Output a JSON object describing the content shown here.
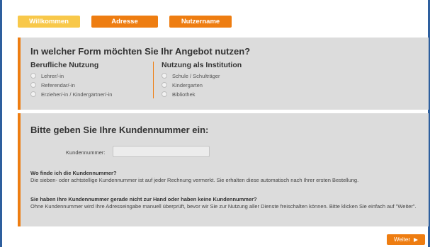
{
  "steps": [
    {
      "label": "Willkommen",
      "state": "done"
    },
    {
      "label": "Adresse",
      "state": "active"
    },
    {
      "label": "Nutzername",
      "state": "active"
    }
  ],
  "usage_section": {
    "title": "In welcher Form möchten Sie Ihr Angebot nutzen?",
    "professional": {
      "title": "Berufliche Nutzung",
      "options": [
        "Lehrer/-in",
        "Referendar/-in",
        "Erzieher/-in / Kindergärtner/-in"
      ]
    },
    "institution": {
      "title": "Nutzung als Institution",
      "options": [
        "Schule / Schulträger",
        "Kindergarten",
        "Bibliothek"
      ]
    }
  },
  "customer_section": {
    "title": "Bitte geben Sie Ihre Kundennummer ein:",
    "field_label": "Kundennummer:",
    "field_value": "",
    "faq": [
      {
        "question": "Wo finde ich die Kundennummer?",
        "answer": "Die sieben- oder achtstellige Kundennummer ist auf jeder Rechnung vermerkt. Sie erhalten diese automatisch nach Ihrer ersten Bestellung."
      },
      {
        "question": "Sie haben Ihre Kundennummer gerade nicht zur Hand oder haben keine Kundennummer?",
        "answer": "Ohne Kundennummer wird Ihre Adresseingabe manuell überprüft, bevor wir Sie zur Nutzung aller Dienste freischalten können. Bitte klicken Sie einfach auf \"Weiter\"."
      }
    ]
  },
  "next_button": {
    "label": "Weiter",
    "icon": "play-icon"
  },
  "colors": {
    "accent": "#ee7d11",
    "step_done": "#f8c84a",
    "panel_bg": "#dcdcdc",
    "frame": "#2e5f9e"
  }
}
